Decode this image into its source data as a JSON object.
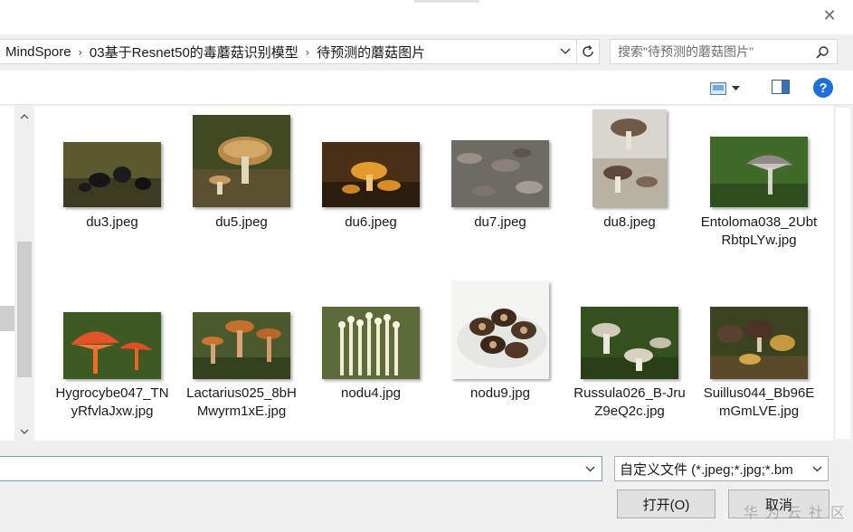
{
  "dialog": {
    "close_label": "✕"
  },
  "breadcrumb": [
    {
      "label": "MindSpore"
    },
    {
      "label": "03基于Resnet50的毒蘑菇识别模型"
    },
    {
      "label": "待预测的蘑菇图片"
    }
  ],
  "search": {
    "placeholder": "搜索\"待预测的蘑菇图片\""
  },
  "toolbar": {
    "help_label": "?"
  },
  "files": [
    {
      "name": "du3.jpeg",
      "icon": "mushroom-thumbnail"
    },
    {
      "name": "du5.jpeg",
      "icon": "mushroom-thumbnail"
    },
    {
      "name": "du6.jpeg",
      "icon": "mushroom-thumbnail"
    },
    {
      "name": "du7.jpeg",
      "icon": "mushroom-thumbnail"
    },
    {
      "name": "du8.jpeg",
      "icon": "mushroom-thumbnail"
    },
    {
      "name": "Entoloma038_2UbtRbtpLYw.jpg",
      "icon": "mushroom-thumbnail"
    },
    {
      "name": "Hygrocybe047_TNyRfvlaJxw.jpg",
      "icon": "mushroom-thumbnail"
    },
    {
      "name": "Lactarius025_8bHMwyrm1xE.jpg",
      "icon": "mushroom-thumbnail"
    },
    {
      "name": "nodu4.jpg",
      "icon": "mushroom-thumbnail"
    },
    {
      "name": "nodu9.jpg",
      "icon": "mushroom-thumbnail"
    },
    {
      "name": "Russula026_B-JruZ9eQ2c.jpg",
      "icon": "mushroom-thumbnail"
    },
    {
      "name": "Suillus044_Bb96EmGmLVE.jpg",
      "icon": "mushroom-thumbnail"
    }
  ],
  "filename_field": {
    "value": ""
  },
  "filetype": {
    "selected": "自定义文件 (*.jpeg;*.jpg;*.bm"
  },
  "buttons": {
    "open": "打开(O)",
    "cancel": "取消"
  },
  "watermark": "华为云社区",
  "colors": {
    "accent": "#1e6fd9",
    "input_border": "#7a9cc6",
    "button_bg": "#e1e1e1"
  }
}
